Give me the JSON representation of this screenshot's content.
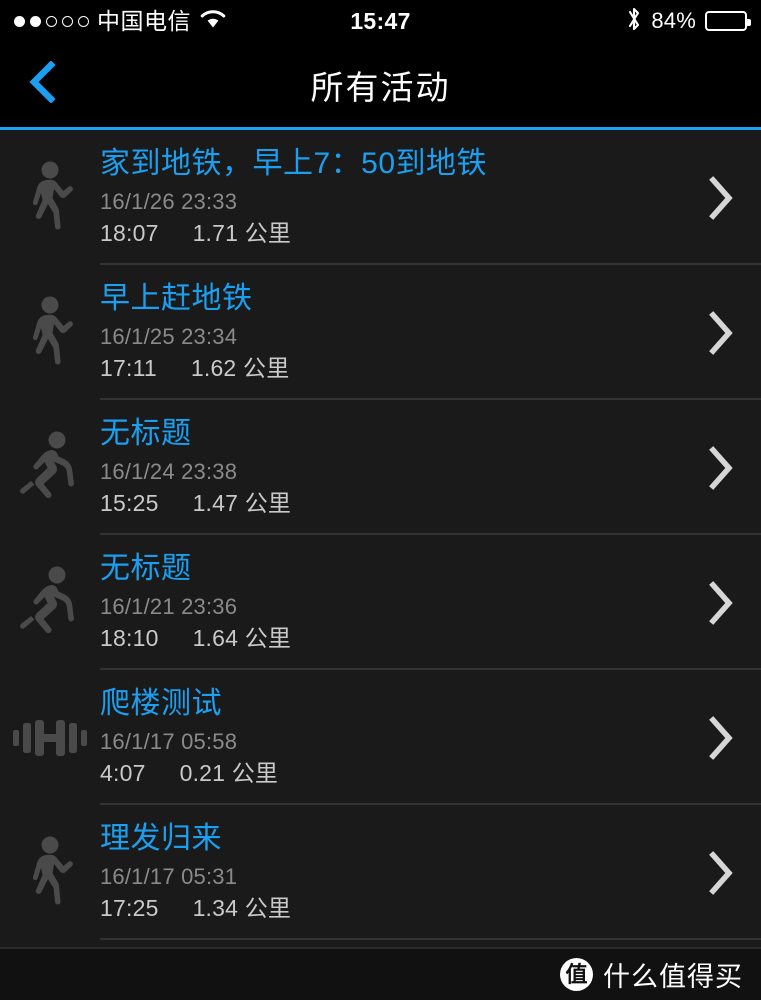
{
  "status_bar": {
    "carrier": "中国电信",
    "signal_dots_filled": 2,
    "signal_dots_total": 5,
    "wifi_icon": "wifi-icon",
    "time": "15:47",
    "bluetooth_icon": "bluetooth-icon",
    "battery_percent": "84%",
    "battery_level": 84
  },
  "nav": {
    "back_icon": "chevron-left-icon",
    "title": "所有活动",
    "accent_color": "#1b9ff0"
  },
  "colors": {
    "accent": "#1b9ff0",
    "list_background": "#1a1a1a",
    "title_text": "#1b9ff0",
    "date_text": "#8a8a8a",
    "stats_text": "#c9c9c9",
    "icon_fill": "#4a4a4a",
    "divider": "#333333"
  },
  "activities": [
    {
      "icon": "walking-icon",
      "title": "家到地铁，早上7：50到地铁",
      "date": "16/1/26 23:33",
      "duration": "18:07",
      "distance": "1.71 公里",
      "chevron": "chevron-right-icon"
    },
    {
      "icon": "walking-icon",
      "title": "早上赶地铁",
      "date": "16/1/25 23:34",
      "duration": "17:11",
      "distance": "1.62 公里",
      "chevron": "chevron-right-icon"
    },
    {
      "icon": "running-icon",
      "title": "无标题",
      "date": "16/1/24 23:38",
      "duration": "15:25",
      "distance": "1.47 公里",
      "chevron": "chevron-right-icon"
    },
    {
      "icon": "running-icon",
      "title": "无标题",
      "date": "16/1/21 23:36",
      "duration": "18:10",
      "distance": "1.64 公里",
      "chevron": "chevron-right-icon"
    },
    {
      "icon": "dumbbell-icon",
      "title": "爬楼测试",
      "date": "16/1/17 05:58",
      "duration": "4:07",
      "distance": "0.21 公里",
      "chevron": "chevron-right-icon"
    },
    {
      "icon": "walking-icon",
      "title": "理发归来",
      "date": "16/1/17 05:31",
      "duration": "17:25",
      "distance": "1.34 公里",
      "chevron": "chevron-right-icon"
    }
  ],
  "watermark": {
    "logo_text": "值",
    "label": "什么值得买"
  }
}
